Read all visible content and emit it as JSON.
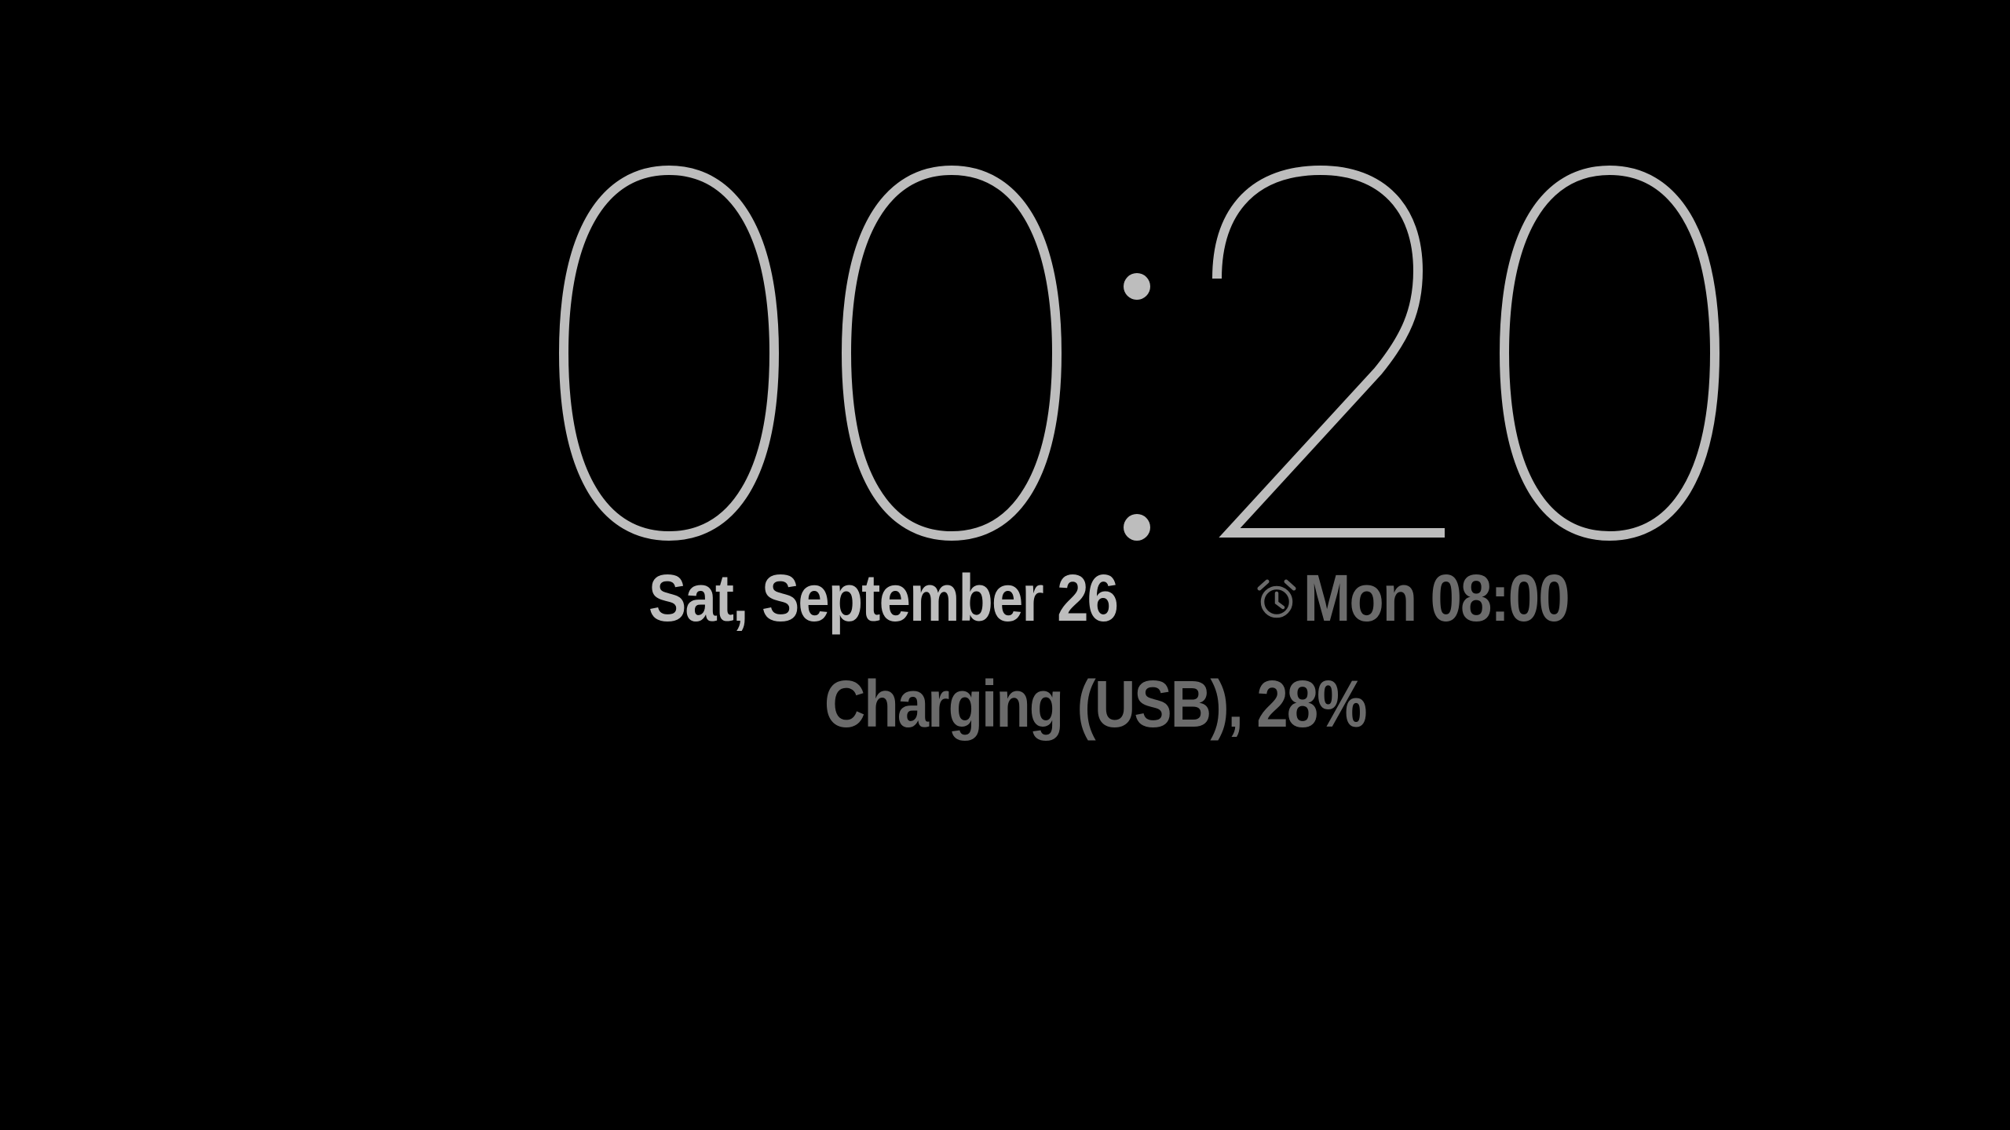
{
  "clock": {
    "time": "00:20",
    "color": "#bdbdbd"
  },
  "date": {
    "text": "Sat, September 26",
    "color": "#bdbdbd"
  },
  "alarm": {
    "icon": "alarm-clock-icon",
    "text": "Mon 08:00",
    "color": "#6b6b6b"
  },
  "battery": {
    "status_text": "Charging (USB), 28%",
    "color": "#6b6b6b"
  },
  "background_color": "#000000"
}
